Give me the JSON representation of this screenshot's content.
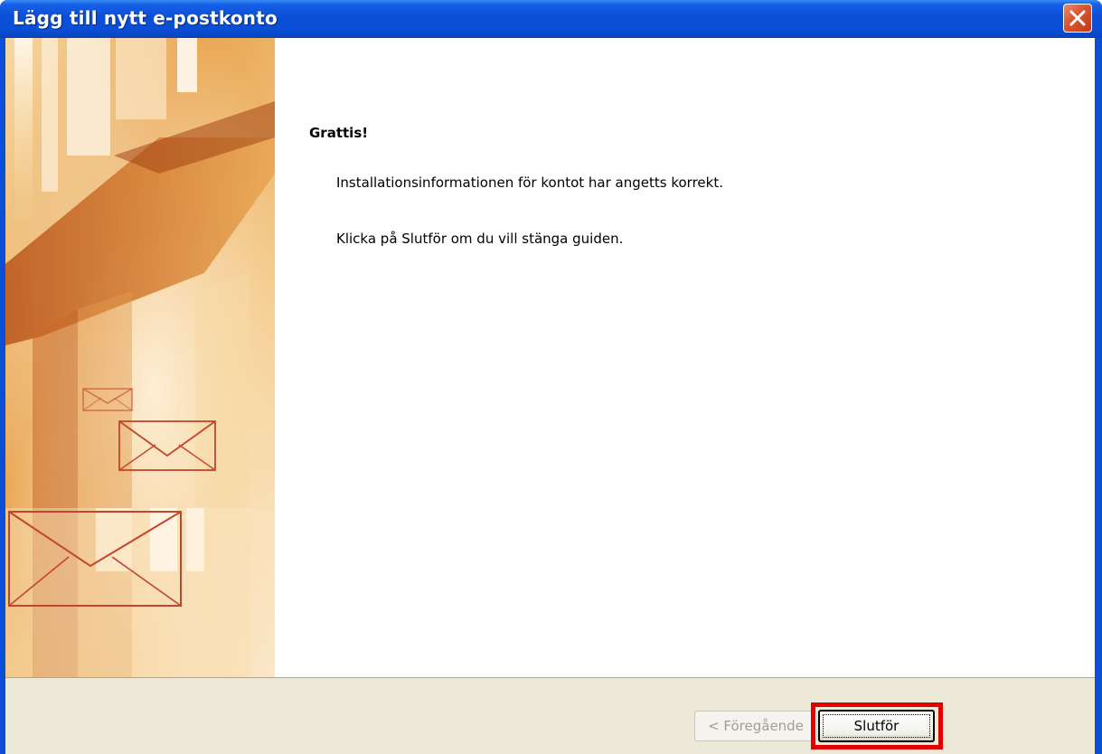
{
  "window": {
    "title": "Lägg till nytt e-postkonto"
  },
  "content": {
    "heading": "Grattis!",
    "line1": "Installationsinformationen för kontot har angetts korrekt.",
    "line2": "Klicka på Slutför om du vill stänga guiden."
  },
  "footer": {
    "prev_label": "< Föregående",
    "finish_label": "Slutför"
  },
  "colors": {
    "titlebar": "#0a4fd6",
    "footer": "#ece9d8",
    "highlight": "#e00000",
    "art_primary": "#d9862f"
  }
}
